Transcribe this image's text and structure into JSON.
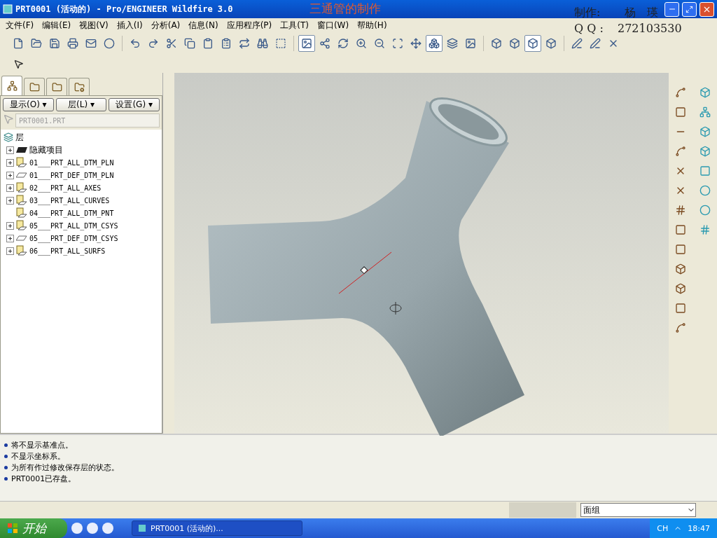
{
  "window": {
    "title": "PRT0001 (活动的) - Pro/ENGINEER Wildfire 3.0"
  },
  "overlay": {
    "caption": "三通管的制作",
    "author_label": "制作:",
    "author_name": "杨　瑛",
    "qq_label": "Q Q :",
    "qq_number": "272103530"
  },
  "menu": [
    "文件(F)",
    "编辑(E)",
    "视图(V)",
    "插入(I)",
    "分析(A)",
    "信息(N)",
    "应用程序(P)",
    "工具(T)",
    "窗口(W)",
    "帮助(H)"
  ],
  "toolbar_buttons": [
    {
      "pressed": false
    },
    {
      "pressed": false
    },
    {
      "pressed": false
    },
    {
      "pressed": false
    },
    {
      "pressed": false
    },
    {
      "pressed": false
    },
    {
      "pressed": false
    },
    {
      "pressed": false
    },
    {
      "pressed": false
    },
    {
      "pressed": false
    },
    {
      "pressed": false
    },
    {
      "pressed": false
    },
    {
      "pressed": false
    },
    {
      "pressed": false
    },
    {
      "pressed": false
    },
    {
      "pressed": true
    },
    {
      "pressed": false
    },
    {
      "pressed": false
    },
    {
      "pressed": false
    },
    {
      "pressed": false
    },
    {
      "pressed": false
    },
    {
      "pressed": false
    },
    {
      "pressed": true
    },
    {
      "pressed": false
    },
    {
      "pressed": false
    },
    {
      "pressed": false
    },
    {
      "pressed": false
    },
    {
      "pressed": true
    },
    {
      "pressed": false
    },
    {
      "pressed": false
    },
    {
      "pressed": false
    },
    {
      "pressed": false
    }
  ],
  "navigator": {
    "tabs": [
      {
        "selected": true
      },
      {
        "selected": false
      },
      {
        "selected": false
      },
      {
        "selected": false
      }
    ],
    "buttons": [
      "显示(O) ▾",
      "层(L) ▾",
      "设置(G) ▾"
    ],
    "model_field": "PRT0001.PRT",
    "root": "层",
    "layers": [
      {
        "name": "隐藏项目",
        "kind": "hidden",
        "expandable": true
      },
      {
        "name": "01___PRT_ALL_DTM_PLN",
        "kind": "layer",
        "expandable": true
      },
      {
        "name": "01___PRT_DEF_DTM_PLN",
        "kind": "plane",
        "expandable": true
      },
      {
        "name": "02___PRT_ALL_AXES",
        "kind": "layer",
        "expandable": true
      },
      {
        "name": "03___PRT_ALL_CURVES",
        "kind": "layer",
        "expandable": true
      },
      {
        "name": "04___PRT_ALL_DTM_PNT",
        "kind": "layer",
        "expandable": false
      },
      {
        "name": "05___PRT_ALL_DTM_CSYS",
        "kind": "layer",
        "expandable": true
      },
      {
        "name": "05___PRT_DEF_DTM_CSYS",
        "kind": "plane",
        "expandable": true
      },
      {
        "name": "06___PRT_ALL_SURFS",
        "kind": "layer",
        "expandable": true
      }
    ]
  },
  "messages": [
    "将不显示基准点。",
    "不显示坐标系。",
    "为所有作过修改保存层的状态。",
    "PRT0001已存盘。"
  ],
  "status_bar": {
    "filter": "面组"
  },
  "taskbar": {
    "start": "开始",
    "task": "PRT0001 (活动的)...",
    "language": "CH",
    "time": "18:47"
  }
}
